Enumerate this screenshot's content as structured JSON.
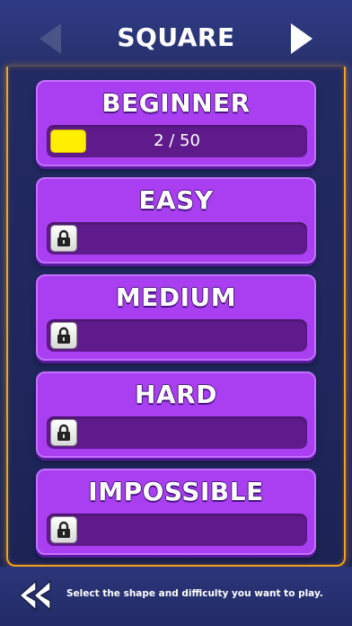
{
  "header": {
    "title": "SQUARE",
    "prev_icon": "triangle-left-icon",
    "next_icon": "triangle-right-icon"
  },
  "levels": [
    {
      "name": "BEGINNER",
      "locked": false,
      "progress_text": "2 / 50",
      "progress_fraction": 0.04
    },
    {
      "name": "EASY",
      "locked": true,
      "icon": "lock-icon"
    },
    {
      "name": "MEDIUM",
      "locked": true,
      "icon": "lock-icon"
    },
    {
      "name": "HARD",
      "locked": true,
      "icon": "lock-icon"
    },
    {
      "name": "IMPOSSIBLE",
      "locked": true,
      "icon": "lock-icon"
    }
  ],
  "footer": {
    "back_icon": "double-chevron-left-icon",
    "instruction": "Select the shape and difficulty you want to play."
  },
  "colors": {
    "background": "#232a5c",
    "header": "#303b86",
    "card": "#a93ff0",
    "bar": "#5f1b8c",
    "progress": "#ffee00",
    "border_accent": "#f3a21b"
  }
}
